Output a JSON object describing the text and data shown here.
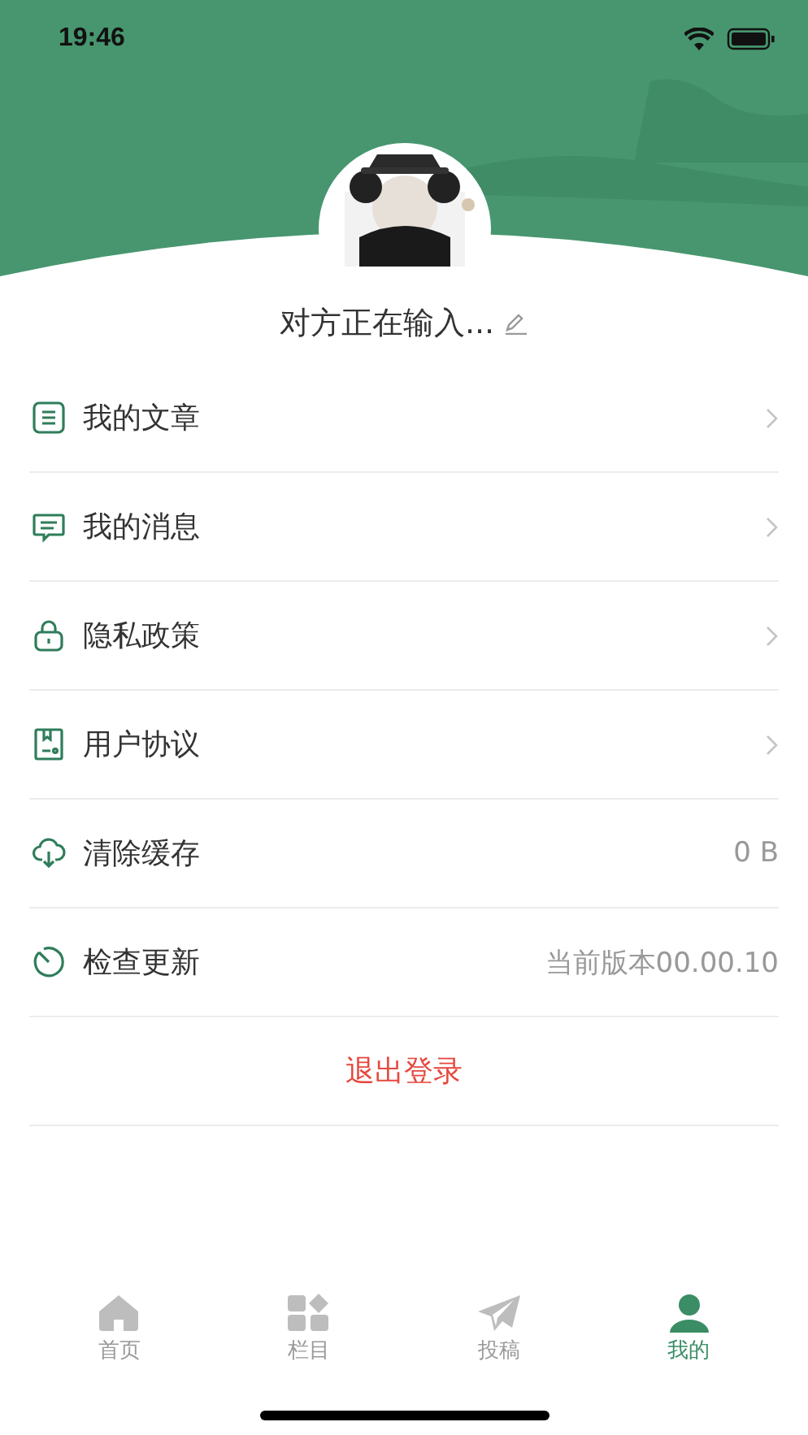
{
  "status_bar": {
    "time": "19:46"
  },
  "profile": {
    "name": "对方正在输入..."
  },
  "menu": [
    {
      "kind": "link",
      "label": "我的文章"
    },
    {
      "kind": "link",
      "label": "我的消息"
    },
    {
      "kind": "link",
      "label": "隐私政策"
    },
    {
      "kind": "link",
      "label": "用户协议"
    },
    {
      "kind": "value",
      "label": "清除缓存",
      "value": "0 B"
    },
    {
      "kind": "value",
      "label": "检查更新",
      "value": "当前版本00.00.10"
    }
  ],
  "logout": {
    "label": "退出登录"
  },
  "tab_bar": [
    {
      "label": "首页",
      "selected": false
    },
    {
      "label": "栏目",
      "selected": false
    },
    {
      "label": "投稿",
      "selected": false
    },
    {
      "label": "我的",
      "selected": true
    }
  ]
}
